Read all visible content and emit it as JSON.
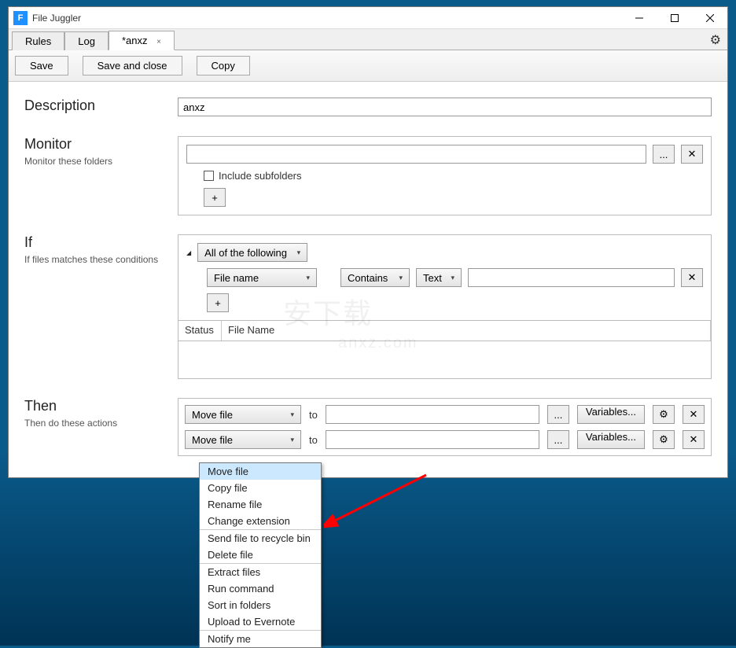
{
  "titlebar": {
    "app_icon_letter": "F",
    "title": "File Juggler"
  },
  "tabs": {
    "rules": "Rules",
    "log": "Log",
    "current": "*anxz",
    "close_x": "×"
  },
  "toolbar": {
    "save": "Save",
    "save_close": "Save and close",
    "copy": "Copy"
  },
  "description": {
    "label": "Description",
    "value": "anxz"
  },
  "monitor": {
    "label": "Monitor",
    "sub": "Monitor these folders",
    "browse": "...",
    "remove": "✕",
    "include_sub": "Include subfolders",
    "add": "+"
  },
  "if": {
    "label": "If",
    "sub": "If files matches these conditions",
    "collapse_tri": "◢",
    "all_of": "All of the following",
    "field": "File name",
    "op": "Contains",
    "type": "Text",
    "add": "+",
    "remove": "✕",
    "th_status": "Status",
    "th_filename": "File Name"
  },
  "then": {
    "label": "Then",
    "sub": "Then do these actions",
    "action1": "Move file",
    "action2": "Move file",
    "to": "to",
    "browse": "...",
    "variables": "Variables...",
    "gear": "⚙",
    "remove": "✕"
  },
  "popup": {
    "items_g1": [
      "Move file",
      "Copy file",
      "Rename file",
      "Change extension"
    ],
    "items_g2": [
      "Send file to recycle bin",
      "Delete file"
    ],
    "items_g3": [
      "Extract files",
      "Run command",
      "Sort in folders",
      "Upload to Evernote"
    ],
    "items_g4": [
      "Notify me"
    ],
    "highlighted": "Move file"
  },
  "watermark": {
    "main": "安下载",
    "sub": "anxz.com"
  }
}
